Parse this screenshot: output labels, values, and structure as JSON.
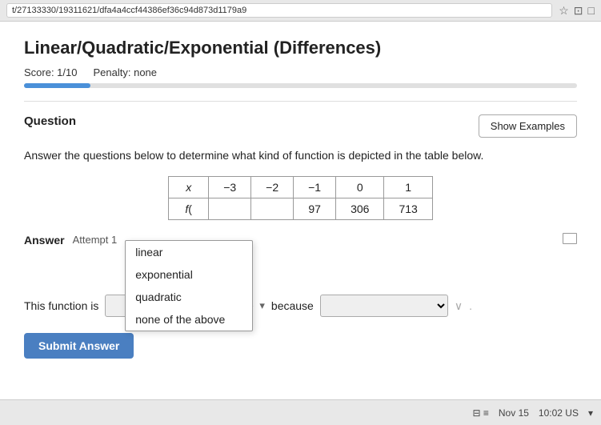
{
  "browser": {
    "url": "t/27133330/19311621/dfa4a4ccf44386ef36c94d873d1179a9",
    "icons": [
      "☆",
      "⊡",
      "□"
    ]
  },
  "page": {
    "title": "Linear/Quadratic/Exponential (Differences)",
    "score_label": "Score: 1/10",
    "penalty_label": "Penalty: none",
    "progress_percent": 12
  },
  "question": {
    "label": "Question",
    "show_examples_label": "Show Examples",
    "text": "Answer the questions below to determine what kind of function is depicted in the table below."
  },
  "table": {
    "headers": [
      "x",
      "-3",
      "-2",
      "-1",
      "0",
      "1"
    ],
    "row1_partial": [
      "",
      "",
      ""
    ],
    "row2": [
      "97",
      "306",
      "713"
    ]
  },
  "answer": {
    "label": "Answer",
    "attempt_label": "Attempt 1",
    "dropdown_placeholder": "",
    "dropdown_options": [
      "linear",
      "exponential",
      "quadratic",
      "none of the above"
    ],
    "dropdown_open": true
  },
  "this_function": {
    "prefix": "This function is",
    "because_label": "because",
    "select_placeholder": "",
    "second_select_placeholder": ""
  },
  "submit": {
    "label": "Submit Answer"
  },
  "taskbar": {
    "date": "Nov 15",
    "time": "10:02 US"
  }
}
